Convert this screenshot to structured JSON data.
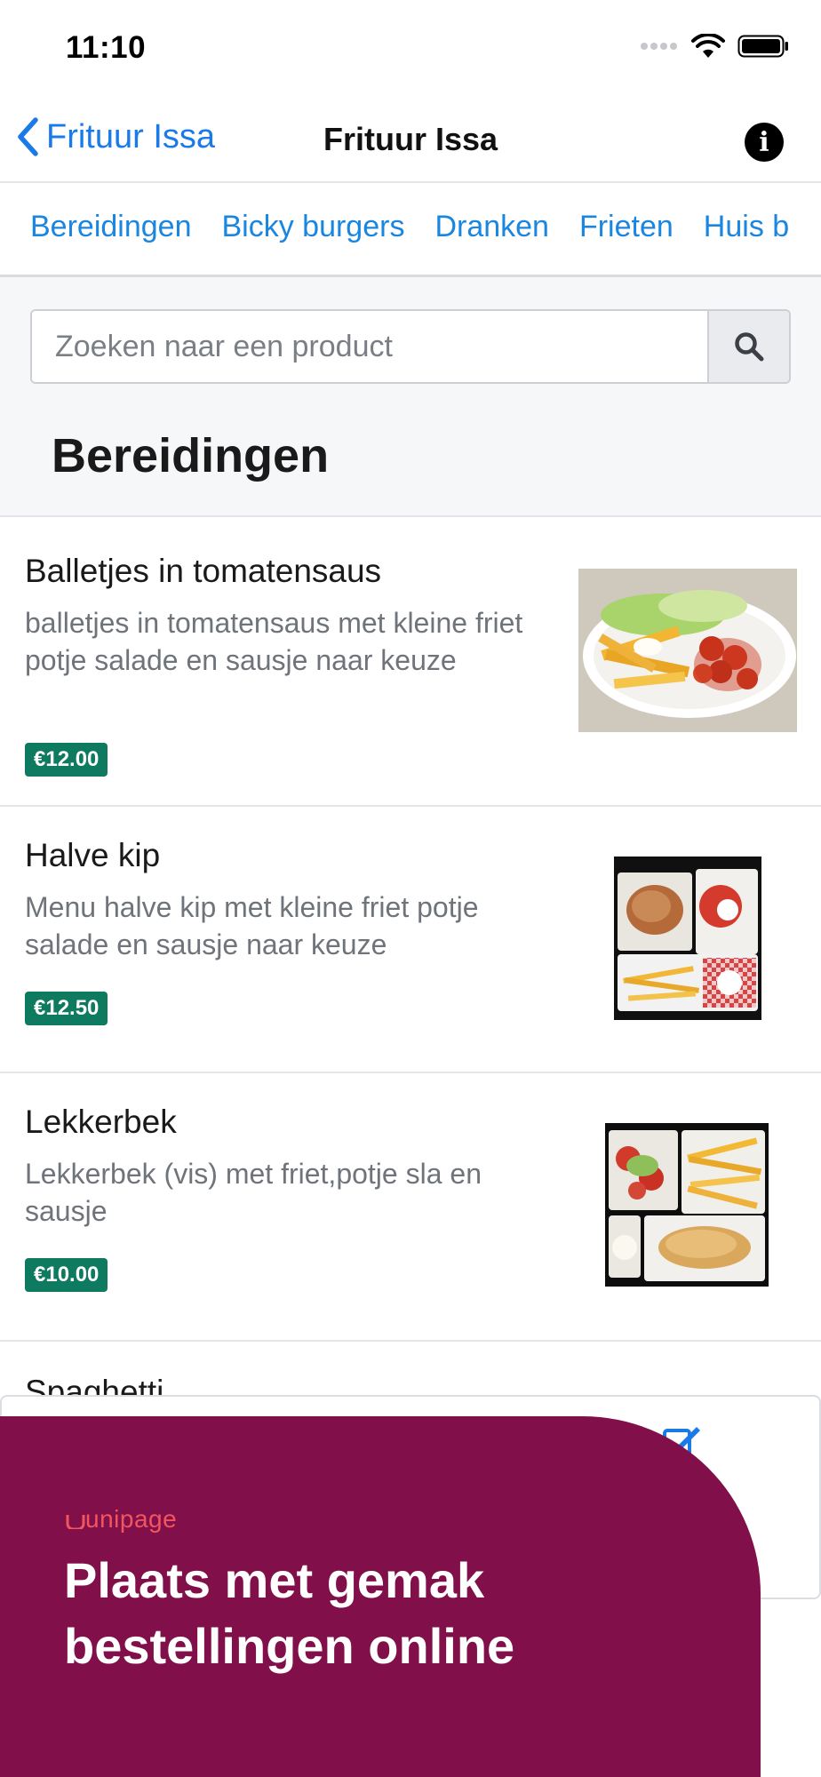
{
  "status_bar": {
    "time": "11:10"
  },
  "nav": {
    "back_label": "Frituur Issa",
    "title": "Frituur Issa"
  },
  "tabs": [
    "Bereidingen",
    "Bicky burgers",
    "Dranken",
    "Frieten",
    "Huis b"
  ],
  "search": {
    "placeholder": "Zoeken naar een product"
  },
  "section": {
    "title": "Bereidingen"
  },
  "products": [
    {
      "name": "Balletjes in tomatensaus",
      "description": "balletjes in tomatensaus met kleine friet potje salade en sausje naar keuze",
      "price": "€12.00"
    },
    {
      "name": "Halve kip",
      "description": "Menu halve kip met kleine friet potje salade en sausje naar keuze",
      "price": "€12.50"
    },
    {
      "name": "Lekkerbek",
      "description": "Lekkerbek (vis) met friet,potje sla en sausje",
      "price": "€10.00"
    },
    {
      "name": "Spaghetti"
    }
  ],
  "promo": {
    "brand": "unipage",
    "headline": "Plaats met gemak bestellingen online"
  },
  "colors": {
    "accent": "#1a86e0",
    "price_badge": "#0e7a5f",
    "promo_bg": "#800f4a",
    "brand": "#f2555f"
  },
  "icons": [
    "chevron-left-icon",
    "info-icon",
    "search-icon",
    "edit-icon",
    "wifi-icon",
    "battery-icon",
    "signal-icon"
  ]
}
